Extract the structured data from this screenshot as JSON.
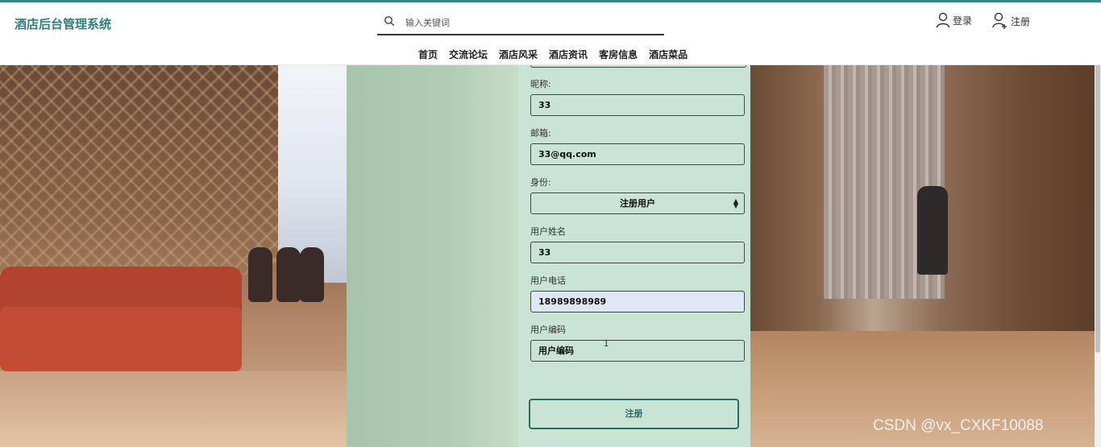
{
  "header": {
    "brand": "酒店后台管理系统",
    "search_placeholder": "输入关键词",
    "login_label": "登录",
    "register_label": "注册"
  },
  "nav": {
    "items": [
      "首页",
      "交流论坛",
      "酒店风采",
      "酒店资讯",
      "客房信息",
      "酒店菜品"
    ]
  },
  "form": {
    "nickname_label": "昵称:",
    "nickname_value": "33",
    "email_label": "邮箱:",
    "email_value": "33@qq.com",
    "role_label": "身份:",
    "role_value": "注册用户",
    "name_label": "用户姓名",
    "name_value": "33",
    "phone_label": "用户电话",
    "phone_value": "18989898989",
    "code_label": "用户编码",
    "code_value": "用户编码",
    "submit_label": "注册"
  },
  "watermark": "CSDN @vx_CXKF10088",
  "colors": {
    "accent": "#2f8c86",
    "form_bg": "#c9e3d4",
    "left_panel": "#a7c5ac",
    "filled_input": "#dfe6f6"
  }
}
